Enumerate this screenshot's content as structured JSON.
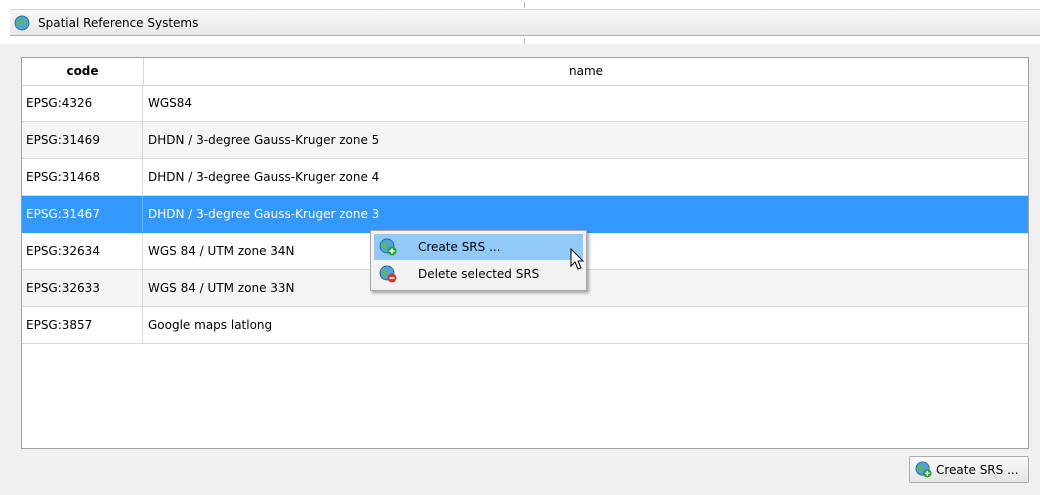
{
  "window": {
    "tab_title": "Spatial Reference Systems",
    "tab_icon": "globe-icon"
  },
  "table": {
    "columns": [
      "code",
      "name"
    ],
    "rows": [
      {
        "code": "EPSG:4326",
        "name": "WGS84"
      },
      {
        "code": "EPSG:31469",
        "name": "DHDN / 3-degree Gauss-Kruger zone 5"
      },
      {
        "code": "EPSG:31468",
        "name": "DHDN / 3-degree Gauss-Kruger zone 4"
      },
      {
        "code": "EPSG:31467",
        "name": "DHDN / 3-degree Gauss-Kruger zone 3"
      },
      {
        "code": "EPSG:32634",
        "name": "WGS 84 / UTM zone 34N"
      },
      {
        "code": "EPSG:32633",
        "name": "WGS 84 / UTM zone 33N"
      },
      {
        "code": "EPSG:3857",
        "name": "Google maps latlong"
      }
    ],
    "selected_row_index": 3
  },
  "context_menu": {
    "items": [
      {
        "label": "Create SRS ...",
        "icon": "globe-add-icon",
        "highlighted": true
      },
      {
        "label": "Delete selected SRS",
        "icon": "globe-delete-icon",
        "highlighted": false
      }
    ]
  },
  "footer": {
    "create_button_label": "Create SRS ...",
    "create_button_icon": "globe-add-icon"
  },
  "colors": {
    "selection": "#3399ff",
    "menu_highlight": "#91c9f7",
    "add_badge": "#2e9e3c",
    "delete_badge": "#d9342b"
  }
}
